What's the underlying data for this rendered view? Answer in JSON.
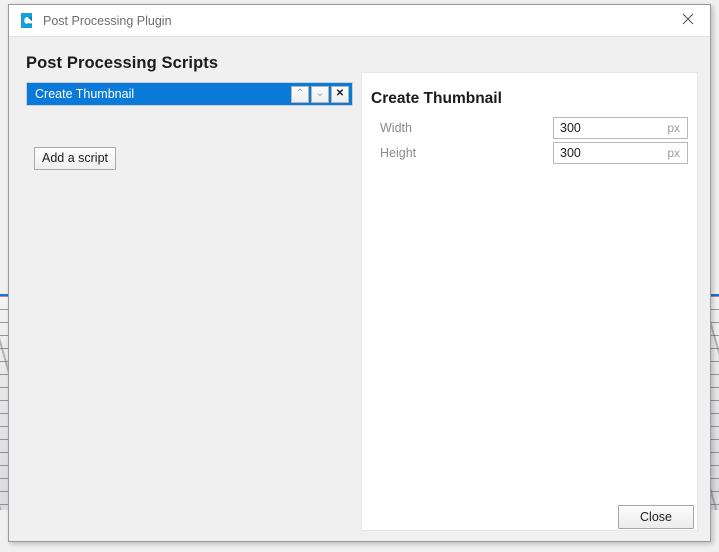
{
  "window": {
    "title": "Post Processing Plugin",
    "app_icon": "capture-one-logo-icon",
    "close_icon": "close-icon",
    "accent_color": "#0a7ad8",
    "titlebar_background": "#ffffff",
    "dialog_background": "#f0f0f0"
  },
  "left_pane": {
    "heading": "Post Processing Scripts",
    "scripts": [
      {
        "label": "Create Thumbnail",
        "selected": true,
        "move_up_label": "⌃",
        "move_down_label": "⌄",
        "remove_label": "✕"
      }
    ],
    "add_script_label": "Add a script"
  },
  "right_pane": {
    "heading": "Create Thumbnail",
    "fields": [
      {
        "label": "Width",
        "value": "300",
        "unit": "px",
        "placeholder": "300"
      },
      {
        "label": "Height",
        "value": "300",
        "unit": "px",
        "placeholder": "300"
      }
    ]
  },
  "footer": {
    "close_label": "Close"
  }
}
